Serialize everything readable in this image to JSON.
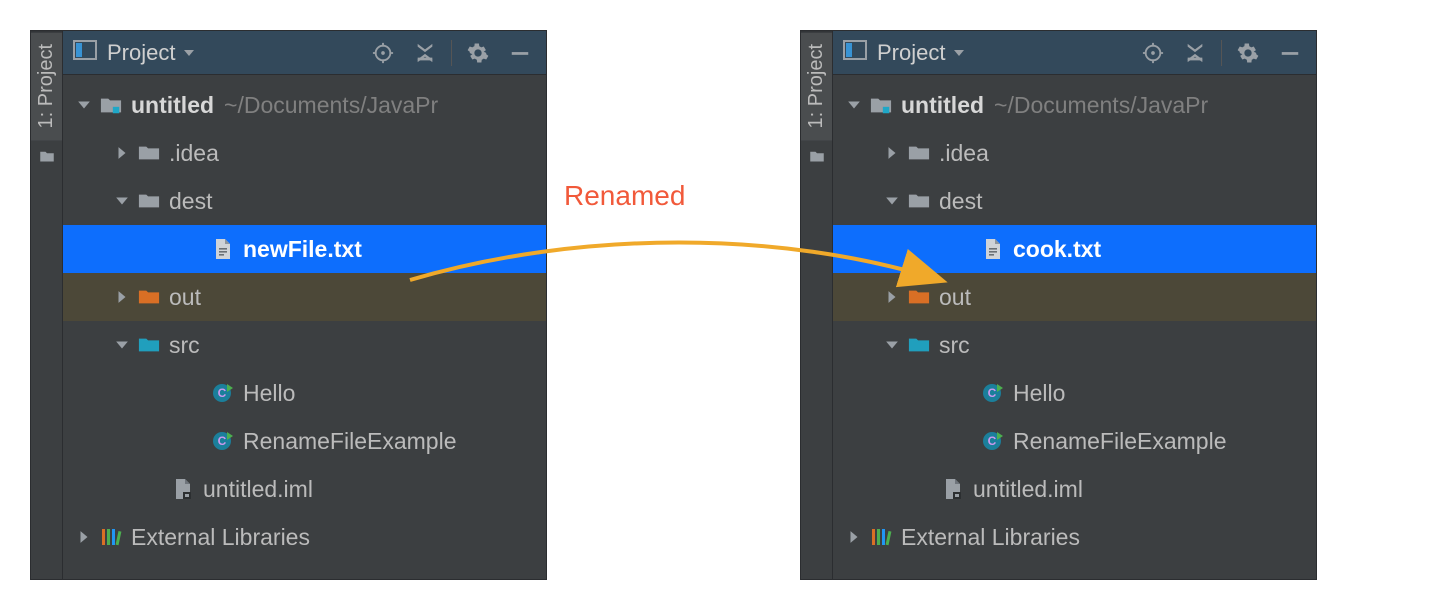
{
  "annotation": {
    "label": "Renamed"
  },
  "panels": {
    "left": {
      "sidebar_tab": "1: Project",
      "toolbar": {
        "title": "Project"
      },
      "tree": {
        "root": {
          "name": "untitled",
          "path": "~/Documents/JavaPr"
        },
        "idea": ".idea",
        "dest": "dest",
        "dest_file": "newFile.txt",
        "out": "out",
        "src": "src",
        "class1": "Hello",
        "class2": "RenameFileExample",
        "iml": "untitled.iml",
        "ext": "External Libraries"
      }
    },
    "right": {
      "sidebar_tab": "1: Project",
      "toolbar": {
        "title": "Project"
      },
      "tree": {
        "root": {
          "name": "untitled",
          "path": "~/Documents/JavaPr"
        },
        "idea": ".idea",
        "dest": "dest",
        "dest_file": "cook.txt",
        "out": "out",
        "src": "src",
        "class1": "Hello",
        "class2": "RenameFileExample",
        "iml": "untitled.iml",
        "ext": "External Libraries"
      }
    }
  }
}
